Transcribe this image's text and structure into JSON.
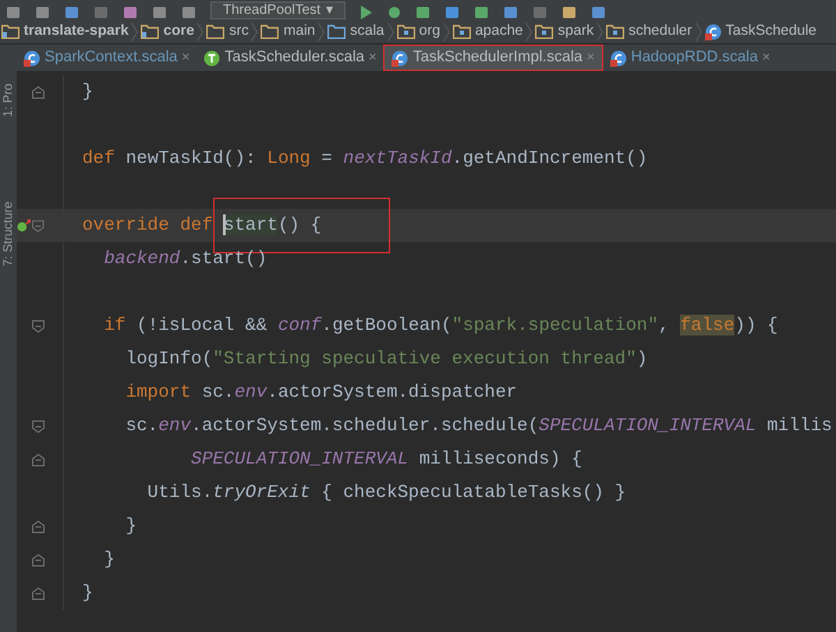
{
  "toolbar": {
    "run_config": "ThreadPoolTest",
    "dropdown_arrow": "▾"
  },
  "breadcrumbs": [
    {
      "label": "translate-spark",
      "kind": "module"
    },
    {
      "label": "core",
      "kind": "module"
    },
    {
      "label": "src",
      "kind": "folder"
    },
    {
      "label": "main",
      "kind": "folder"
    },
    {
      "label": "scala",
      "kind": "source"
    },
    {
      "label": "org",
      "kind": "package"
    },
    {
      "label": "apache",
      "kind": "package"
    },
    {
      "label": "spark",
      "kind": "package"
    },
    {
      "label": "scheduler",
      "kind": "package"
    },
    {
      "label": "TaskSchedule",
      "kind": "class"
    }
  ],
  "side_strip": [
    "1: Pro",
    "7: Structure"
  ],
  "tabs": [
    {
      "label": "SparkContext.scala",
      "kind": "class",
      "selected": false,
      "modified": true,
      "marked": false,
      "close": "×"
    },
    {
      "label": "TaskScheduler.scala",
      "kind": "trait",
      "selected": false,
      "modified": false,
      "marked": false,
      "close": "×"
    },
    {
      "label": "TaskSchedulerImpl.scala",
      "kind": "class",
      "selected": true,
      "modified": false,
      "marked": true,
      "close": "×"
    },
    {
      "label": "HadoopRDD.scala",
      "kind": "class",
      "selected": false,
      "modified": true,
      "marked": false,
      "close": "×"
    }
  ],
  "editor": {
    "lines": [
      {
        "current": false,
        "fold_start": false,
        "fold_end": true,
        "override_marker": false,
        "tokens": [
          {
            "text": "}",
            "kind": "plain"
          }
        ]
      },
      {
        "current": false,
        "fold_start": false,
        "fold_end": false,
        "override_marker": false
      },
      {
        "current": false,
        "fold_start": false,
        "fold_end": false,
        "override_marker": false,
        "tokens": [
          {
            "text": "def ",
            "kind": "keyword"
          },
          {
            "text": "newTaskId(): ",
            "kind": "plain"
          },
          {
            "text": "Long",
            "kind": "keyword"
          },
          {
            "text": " = ",
            "kind": "plain"
          },
          {
            "text": "nextTaskId",
            "kind": "field"
          },
          {
            "text": ".getAndIncrement()",
            "kind": "plain"
          }
        ]
      },
      {
        "current": false,
        "fold_start": false,
        "fold_end": false,
        "override_marker": false
      },
      {
        "current": true,
        "fold_start": true,
        "fold_end": false,
        "override_marker": true,
        "tokens": [
          {
            "text": "override def ",
            "kind": "keyword"
          },
          {
            "text": "start",
            "kind": "plain",
            "highlight": true,
            "caret": true,
            "boxed": true
          },
          {
            "text": "() {",
            "kind": "plain",
            "boxed": true
          }
        ]
      },
      {
        "current": false,
        "fold_start": false,
        "fold_end": false,
        "override_marker": false,
        "tokens": [
          {
            "text": "  backend",
            "kind": "field"
          },
          {
            "text": ".start()",
            "kind": "plain"
          }
        ]
      },
      {
        "current": false,
        "fold_start": false,
        "fold_end": false,
        "override_marker": false
      },
      {
        "current": false,
        "fold_start": true,
        "fold_end": false,
        "override_marker": false,
        "tokens": [
          {
            "text": "  if",
            "kind": "keyword"
          },
          {
            "text": " (!isLocal && ",
            "kind": "plain"
          },
          {
            "text": "conf",
            "kind": "field"
          },
          {
            "text": ".getBoolean(",
            "kind": "plain"
          },
          {
            "text": "\"spark.speculation\"",
            "kind": "string"
          },
          {
            "text": ", ",
            "kind": "plain"
          },
          {
            "text": "false",
            "kind": "keyword",
            "highlight": true
          },
          {
            "text": ")) {",
            "kind": "plain"
          }
        ]
      },
      {
        "current": false,
        "fold_start": false,
        "fold_end": false,
        "override_marker": false,
        "tokens": [
          {
            "text": "    logInfo(",
            "kind": "plain"
          },
          {
            "text": "\"Starting speculative execution thread\"",
            "kind": "string"
          },
          {
            "text": ")",
            "kind": "plain"
          }
        ]
      },
      {
        "current": false,
        "fold_start": false,
        "fold_end": false,
        "override_marker": false,
        "tokens": [
          {
            "text": "    import",
            "kind": "keyword"
          },
          {
            "text": " sc.",
            "kind": "plain"
          },
          {
            "text": "env",
            "kind": "field"
          },
          {
            "text": ".actorSystem.dispatcher",
            "kind": "plain"
          }
        ]
      },
      {
        "current": false,
        "fold_start": true,
        "fold_end": false,
        "override_marker": false,
        "tokens": [
          {
            "text": "    sc.",
            "kind": "plain"
          },
          {
            "text": "env",
            "kind": "field"
          },
          {
            "text": ".actorSystem.scheduler.schedule(",
            "kind": "plain"
          },
          {
            "text": "SPECULATION_INTERVAL",
            "kind": "field"
          },
          {
            "text": " millis",
            "kind": "plain"
          }
        ]
      },
      {
        "current": false,
        "fold_start": false,
        "fold_end": true,
        "override_marker": false,
        "tokens": [
          {
            "text": "          SPECULATION_INTERVAL",
            "kind": "field"
          },
          {
            "text": " milliseconds) {",
            "kind": "plain"
          }
        ]
      },
      {
        "current": false,
        "fold_start": false,
        "fold_end": false,
        "override_marker": false,
        "tokens": [
          {
            "text": "      Utils.",
            "kind": "plain"
          },
          {
            "text": "tryOrExit",
            "kind": "method"
          },
          {
            "text": " { checkSpeculatableTasks() }",
            "kind": "plain"
          }
        ]
      },
      {
        "current": false,
        "fold_start": false,
        "fold_end": true,
        "override_marker": false,
        "tokens": [
          {
            "text": "    }",
            "kind": "plain"
          }
        ]
      },
      {
        "current": false,
        "fold_start": false,
        "fold_end": true,
        "override_marker": false,
        "tokens": [
          {
            "text": "  }",
            "kind": "plain"
          }
        ]
      },
      {
        "current": false,
        "fold_start": false,
        "fold_end": true,
        "override_marker": false,
        "tokens": [
          {
            "text": "}",
            "kind": "plain"
          }
        ]
      }
    ]
  }
}
